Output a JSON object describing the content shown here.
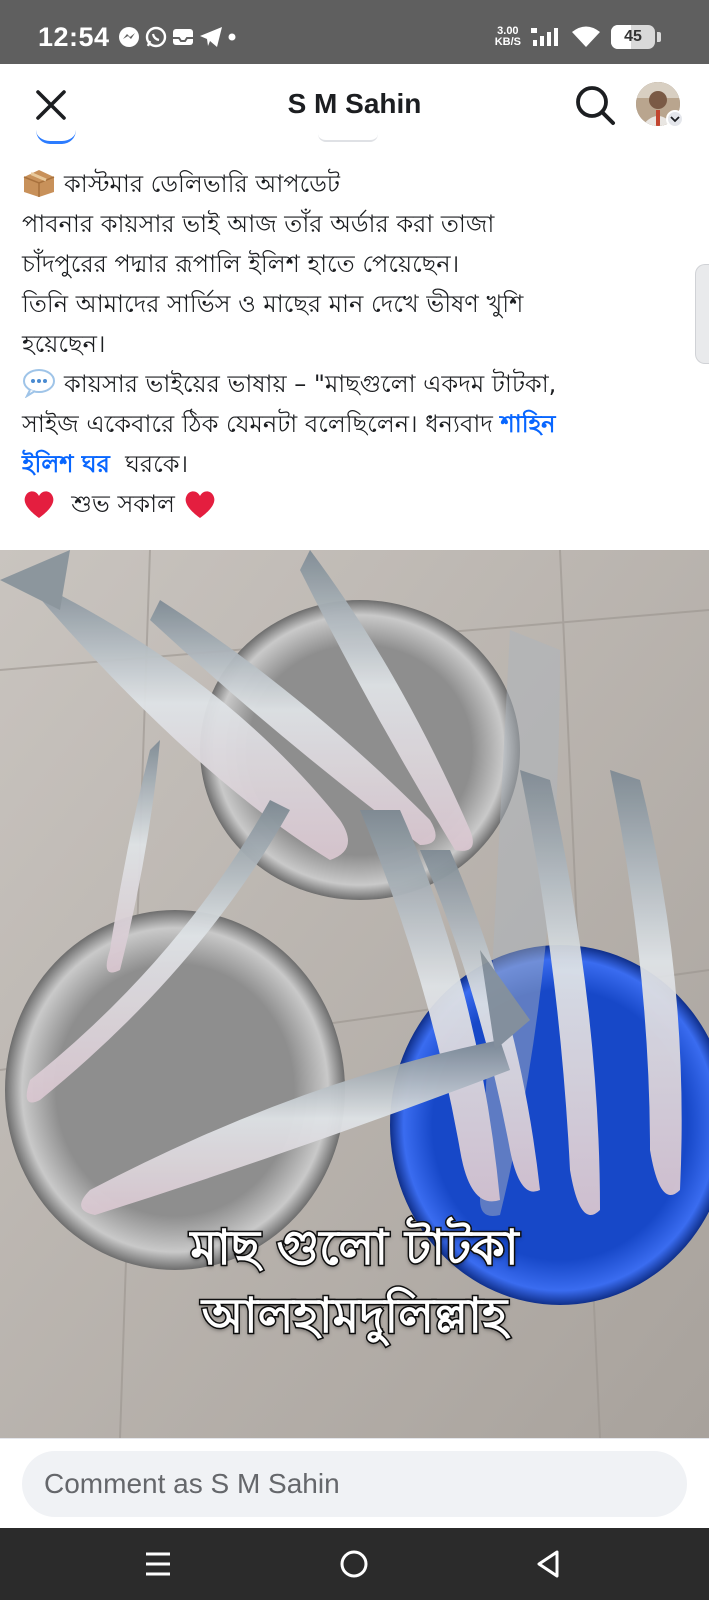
{
  "status_bar": {
    "time": "12:54",
    "net_speed_value": "3.00",
    "net_speed_unit": "KB/S",
    "battery_level": "45",
    "battery_fraction": 0.45
  },
  "header": {
    "title": "S M Sahin"
  },
  "post": {
    "lines": [
      "কাস্টমার ডেলিভারি আপডেট",
      "পাবনার কায়সার ভাই আজ তাঁর অর্ডার করা তাজা",
      "চাঁদপুরের পদ্মার রূপালি ইলিশ হাতে পেয়েছেন।",
      "তিনি আমাদের সার্ভিস ও মাছের মান দেখে ভীষণ খুশি",
      "হয়েছেন।",
      "কায়সার ভাইয়ের ভাষায় – \"মাছগুলো একদম টাটকা,",
      "সাইজ একেবারে ঠিক যেমনটা বলেছিলেন। ধন্যবাদ",
      "ইলিশ ঘর",
      "ঘরকে।",
      "শুভ সকাল"
    ],
    "mention_part1": "শাহিন",
    "icons": {
      "line1": "package-icon",
      "line6": "speech-bubble-icon",
      "line_last": "heart-icon"
    }
  },
  "image": {
    "caption_line1": "মাছ গুলো টাটকা",
    "caption_line2": "আলহামদুলিল্লাহ"
  },
  "comment": {
    "placeholder": "Comment as S M Sahin"
  },
  "colors": {
    "link": "#0866ff",
    "heart": "#e41e3f",
    "nav_bg": "#2b2b2b",
    "status_bg": "#5f5f5f"
  }
}
